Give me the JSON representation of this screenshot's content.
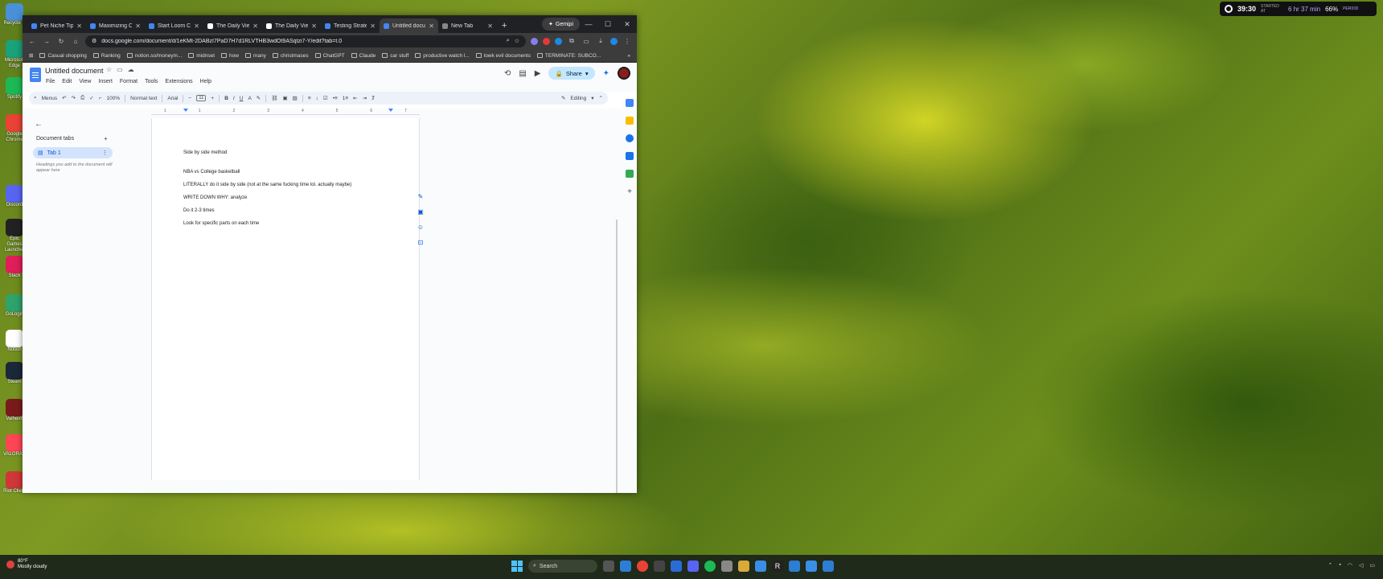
{
  "desktop": {
    "icons": [
      {
        "label": "Recycle B",
        "color": "#4a90d9"
      },
      {
        "label": "Microsoft Edge",
        "color": "#1aa37a"
      },
      {
        "label": "Spotify",
        "color": "#1db954"
      },
      {
        "label": "Google Chrome",
        "color": "#ea4335"
      },
      {
        "label": "Discord",
        "color": "#5865f2"
      },
      {
        "label": "Epic Games Launcher",
        "color": "#222222"
      },
      {
        "label": "Slack",
        "color": "#e01e5a"
      },
      {
        "label": "GoLogin",
        "color": "#2fa36b"
      },
      {
        "label": "Notion",
        "color": "#ffffff"
      },
      {
        "label": "Steam",
        "color": "#1b2838"
      },
      {
        "label": "Valheim",
        "color": "#7a1b1b"
      },
      {
        "label": "VALORANT",
        "color": "#ff4655"
      },
      {
        "label": "Riot Client",
        "color": "#d13639"
      }
    ]
  },
  "status_widget": {
    "time": "39:30",
    "small1": "STARTED AT",
    "remaining": "6 hr 37 min",
    "percent": "66%",
    "small2": "PERIOD"
  },
  "browser": {
    "tabs": [
      {
        "title": "Pet Niche Tips",
        "color": "#4285f4"
      },
      {
        "title": "Maximizing Co",
        "color": "#4285f4"
      },
      {
        "title": "Start Loom Cr",
        "color": "#4285f4"
      },
      {
        "title": "The Daily Vie",
        "color": "#ffffff"
      },
      {
        "title": "The Daily Vie",
        "color": "#ffffff"
      },
      {
        "title": "Testing Strate",
        "color": "#4285f4"
      },
      {
        "title": "Untitled docu",
        "color": "#4285f4",
        "active": true
      },
      {
        "title": "New Tab",
        "color": "#888888"
      }
    ],
    "new_tab_glyph": "+",
    "gemini_label": "Gemini",
    "url": "docs.google.com/document/d/1eKMt-2DABzI7PaD7H7d1RLVTHB3wdOt9ASqtzi7-Y/edit?tab=t.0",
    "bookmarks": [
      "Casual shopping",
      "Ranking",
      "notion.so/moneym...",
      "midnset",
      "how",
      "many",
      "christmases",
      "ChatGPT",
      "Claude",
      "car stuff",
      "productive watch l...",
      "lowk evil documents",
      "TERMINATE: SUBCO..."
    ]
  },
  "docs": {
    "title": "Untitled document",
    "menu": [
      "File",
      "Edit",
      "View",
      "Insert",
      "Format",
      "Tools",
      "Extensions",
      "Help"
    ],
    "share_label": "Share",
    "format_bar": {
      "menus": "Menus",
      "zoom": "100%",
      "style": "Normal text",
      "font": "Arial",
      "size": "11",
      "mode": "Editing"
    },
    "ruler_ticks": [
      "1",
      "1",
      "2",
      "3",
      "4",
      "5",
      "6",
      "7"
    ],
    "sidebar": {
      "heading": "Document tabs",
      "tab_label": "Tab 1",
      "hint": "Headings you add to the document will appear here"
    },
    "content": [
      "Side by side method",
      "NBA vs College basketball",
      "LITERALLY do it side by side (not at the same fucking time lol. actually maybe)",
      "WRITE DOWN WHY: analyze",
      "Do it 2-3 times",
      "Look for specific parts on each time"
    ]
  },
  "taskbar": {
    "weather_temp": "80°F",
    "weather_desc": "Mostly cloudy",
    "search_label": "Search"
  }
}
